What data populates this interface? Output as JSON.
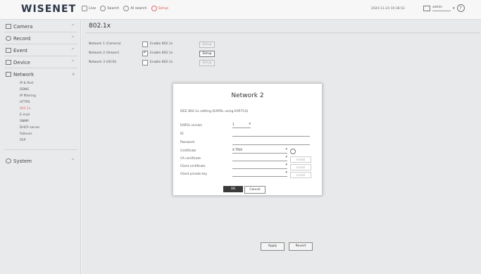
{
  "app": {
    "logo": "WISENET",
    "nav": [
      {
        "label": "Live",
        "icon": "monitor-icon"
      },
      {
        "label": "Search",
        "icon": "search-icon"
      },
      {
        "label": "AI search",
        "icon": "ai-search-icon"
      },
      {
        "label": "Setup",
        "icon": "gear-icon",
        "active": true
      }
    ],
    "datetime": "2020-11-24 10:38:52",
    "user": "admin",
    "help": "?",
    "accent_color": "#e06a6a"
  },
  "sidebar": {
    "items": [
      {
        "label": "Camera",
        "icon": "camera-icon",
        "chevron": "^"
      },
      {
        "label": "Record",
        "icon": "record-icon",
        "chevron": "^"
      },
      {
        "label": "Event",
        "icon": "bell-icon",
        "chevron": "^"
      },
      {
        "label": "Device",
        "icon": "device-icon",
        "chevron": "^"
      },
      {
        "label": "Network",
        "icon": "network-icon",
        "chevron": "v"
      },
      {
        "label": "System",
        "icon": "system-gear-icon",
        "chevron": "^"
      }
    ],
    "network_sub": [
      "IP & Port",
      "DDNS",
      "IP filtering",
      "HTTPS",
      "802.1x",
      "E-mail",
      "SNMP",
      "DHCP server",
      "Failover",
      "P2P"
    ],
    "active_sub": "802.1x"
  },
  "page": {
    "title": "802.1x",
    "rows": [
      {
        "label": "Network 1 (Camera)",
        "checkbox_label": "Enable 802.1x",
        "checked": false,
        "setup_label": "Setup",
        "setup_enabled": false
      },
      {
        "label": "Network 2 (Viewer)",
        "checkbox_label": "Enable 802.1x",
        "checked": true,
        "setup_label": "Setup",
        "setup_enabled": true
      },
      {
        "label": "Network 3 (iSCSI)",
        "checkbox_label": "Enable 802.1x",
        "checked": false,
        "setup_label": "Setup",
        "setup_enabled": false
      }
    ],
    "apply_label": "Apply",
    "revert_label": "Revert"
  },
  "dialog": {
    "title": "Network 2",
    "description": "IEEE 802.1x setting (EAPOL using EAP-TLS)",
    "fields": {
      "eapol_version": {
        "label": "EAPOL version",
        "value": "1"
      },
      "id": {
        "label": "ID",
        "value": ""
      },
      "password": {
        "label": "Password",
        "value": ""
      },
      "certificate": {
        "label": "Certificate",
        "value": "X TRIX"
      },
      "ca_certificate": {
        "label": "CA certificate",
        "value": "",
        "install_label": "Install"
      },
      "client_certificate": {
        "label": "Client certificate",
        "value": "",
        "install_label": "Install"
      },
      "client_private_key": {
        "label": "Client private key",
        "value": "",
        "install_label": "Install"
      }
    },
    "ok_label": "OK",
    "cancel_label": "Cancel"
  }
}
